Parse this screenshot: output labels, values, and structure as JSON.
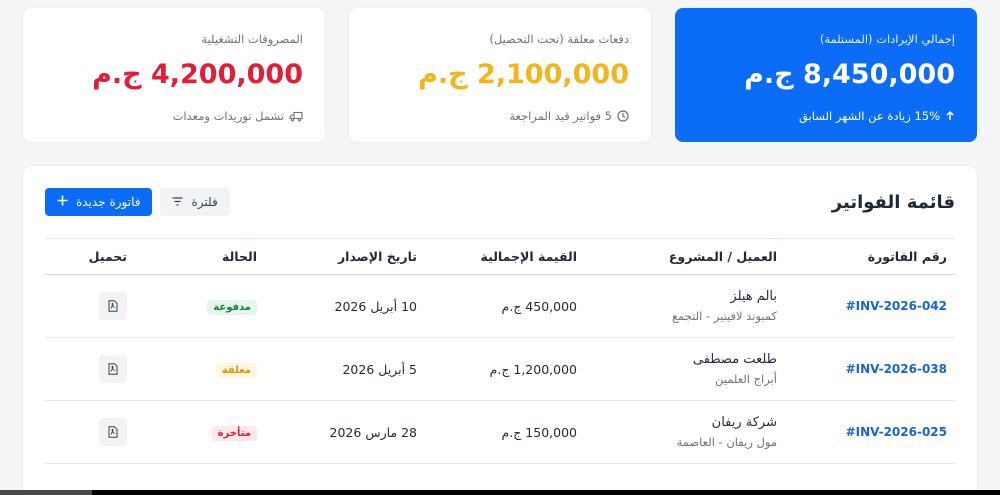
{
  "cards": [
    {
      "label": "إجمالي الإيرادات (المستلمة)",
      "value": "8,450,000 ج.م",
      "note": "15% زيادة عن الشهر السابق",
      "note_icon": "arrow-up-icon"
    },
    {
      "label": "دفعات معلقة (تحت التحصيل)",
      "value": "2,100,000 ج.م",
      "note": "5 فواتير قيد المراجعة",
      "note_icon": "clock-icon"
    },
    {
      "label": "المصروفات التشغيلية",
      "value": "4,200,000 ج.م",
      "note": "تشمل توريدات ومعدات",
      "note_icon": "truck-icon"
    }
  ],
  "panel": {
    "title": "قائمة الفواتير",
    "new_invoice_label": "فاتورة جديدة",
    "filter_label": "فلترة"
  },
  "table": {
    "headers": [
      "رقم الفاتورة",
      "العميل / المشروع",
      "القيمة الإجمالية",
      "تاريخ الإصدار",
      "الحالة",
      "تحميل"
    ],
    "rows": [
      {
        "invoice": "#INV-2026-042",
        "client": "بالم هيلز",
        "project": "كمبوند لافينير - التجمع",
        "amount": "450,000 ج.م",
        "date": "10 أبريل 2026",
        "status": "مدفوعة",
        "status_type": "paid"
      },
      {
        "invoice": "#INV-2026-038",
        "client": "طلعت مصطفى",
        "project": "أبراج العلمين",
        "amount": "1,200,000 ج.م",
        "date": "5 أبريل 2026",
        "status": "معلقة",
        "status_type": "pending"
      },
      {
        "invoice": "#INV-2026-025",
        "client": "شركة ريفان",
        "project": "مول ريفان - العاصمة",
        "amount": "150,000 ج.م",
        "date": "28 مارس 2026",
        "status": "متأخرة",
        "status_type": "late"
      }
    ]
  },
  "colors": {
    "accent": "#0a6cf7",
    "danger": "#e11d38",
    "warning": "#f3b51d",
    "success": "#15803d",
    "link": "#1864d6"
  }
}
